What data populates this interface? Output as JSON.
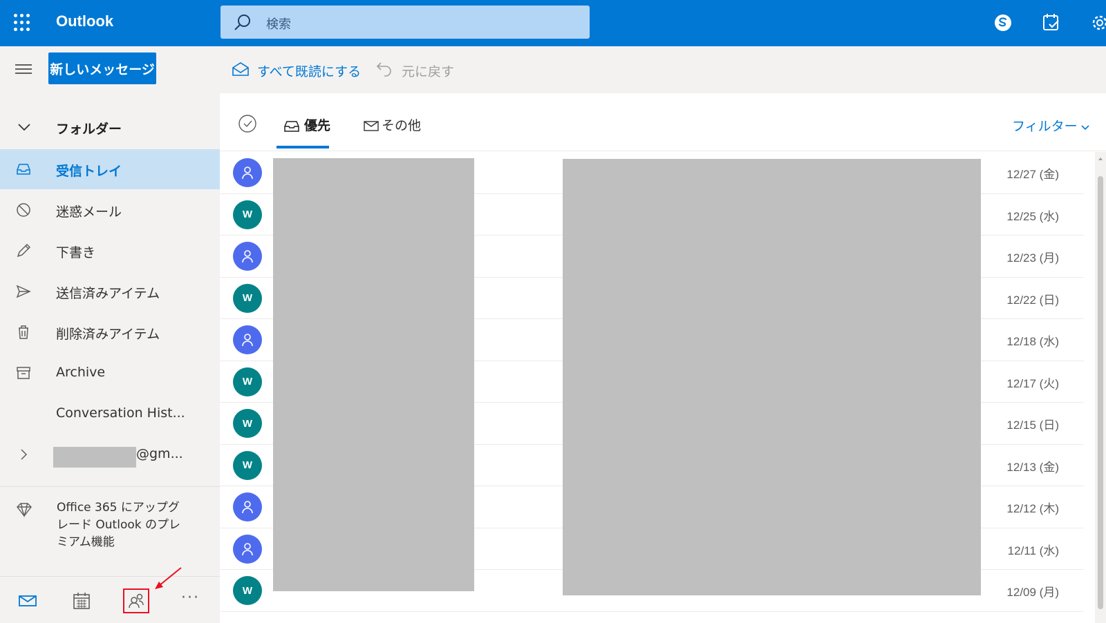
{
  "app": {
    "name": "Outlook"
  },
  "search": {
    "placeholder": "検索"
  },
  "toolbar": {
    "new_message": "新しいメッセージ",
    "mark_all_read": "すべて既読にする",
    "undo": "元に戻す"
  },
  "nav": {
    "folders_header": "フォルダー",
    "items": [
      {
        "label": "受信トレイ",
        "icon": "inbox-icon",
        "active": true
      },
      {
        "label": "迷惑メール",
        "icon": "junk-icon"
      },
      {
        "label": "下書き",
        "icon": "pencil-icon"
      },
      {
        "label": "送信済みアイテム",
        "icon": "send-icon"
      },
      {
        "label": "削除済みアイテム",
        "icon": "trash-icon"
      },
      {
        "label": "Archive",
        "icon": "archive-icon"
      },
      {
        "label": "Conversation Hist...",
        "icon": ""
      }
    ],
    "account_suffix": "@gm...",
    "upgrade": "Office 365 にアップグレード Outlook のプレミアム機能"
  },
  "tabs": {
    "focused": "優先",
    "other": "その他",
    "filter": "フィルター"
  },
  "messages": [
    {
      "avatar": "",
      "avatar_type": "person",
      "date": "12/27 (金)"
    },
    {
      "avatar": "W",
      "avatar_type": "letter",
      "date": "12/25 (水)"
    },
    {
      "avatar": "",
      "avatar_type": "person",
      "date": "12/23 (月)"
    },
    {
      "avatar": "W",
      "avatar_type": "letter",
      "date": "12/22 (日)"
    },
    {
      "avatar": "",
      "avatar_type": "person",
      "date": "12/18 (水)"
    },
    {
      "avatar": "W",
      "avatar_type": "letter",
      "date": "12/17 (火)"
    },
    {
      "avatar": "W",
      "avatar_type": "letter",
      "date": "12/15 (日)"
    },
    {
      "avatar": "W",
      "avatar_type": "letter",
      "date": "12/13 (金)"
    },
    {
      "avatar": "",
      "avatar_type": "person",
      "date": "12/12 (木)"
    },
    {
      "avatar": "",
      "avatar_type": "person",
      "date": "12/11 (水)"
    },
    {
      "avatar": "W",
      "avatar_type": "letter",
      "date": "12/09 (月)"
    }
  ],
  "colors": {
    "brand": "#0078d4",
    "avatar_person": "#4f6bed",
    "avatar_letter": "#038387",
    "highlight": "#e81123"
  }
}
